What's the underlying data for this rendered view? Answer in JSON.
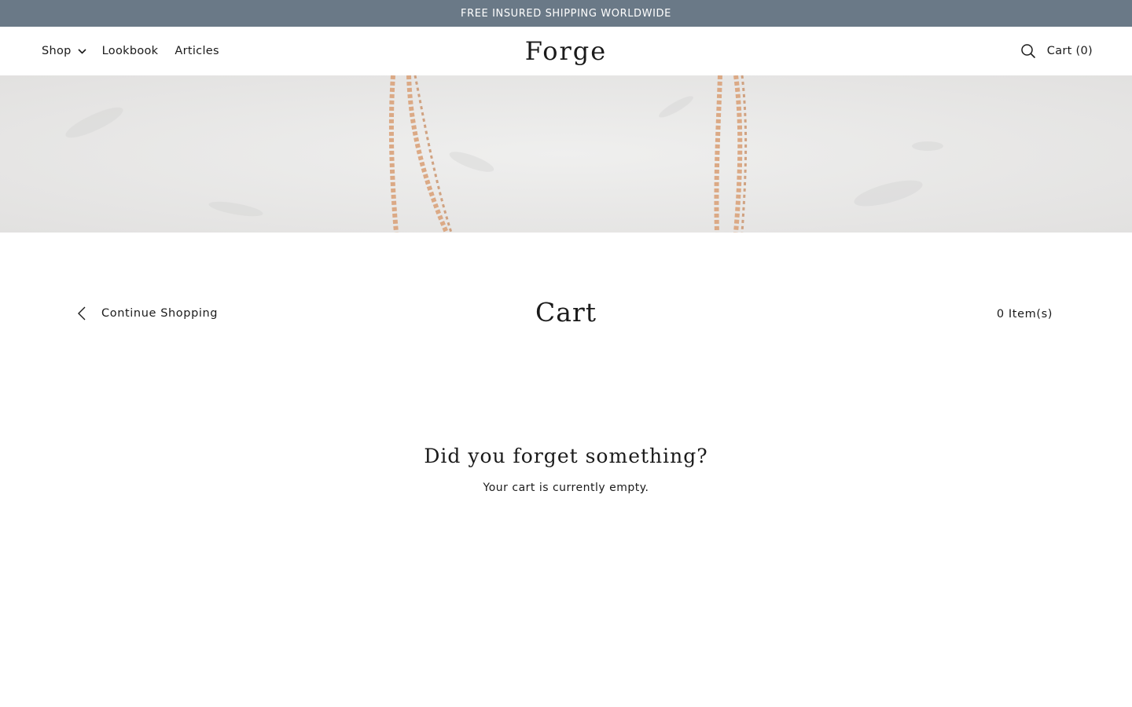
{
  "announcement": {
    "text": "FREE INSURED SHIPPING WORLDWIDE"
  },
  "header": {
    "nav": [
      {
        "label": "Shop"
      },
      {
        "label": "Lookbook"
      },
      {
        "label": "Articles"
      }
    ],
    "logo": "Forge",
    "cart_label": "Cart (0)"
  },
  "cart": {
    "continue_label": "Continue Shopping",
    "title": "Cart",
    "item_count": "0 Item(s)",
    "empty_heading": "Did you forget something?",
    "empty_message": "Your cart is currently empty."
  },
  "icons": {
    "shop_dropdown": "chevron-down-icon",
    "search": "search-icon",
    "back": "chevron-left-icon"
  },
  "colors": {
    "announcement_bg": "#6a7987",
    "announcement_text": "#ffffff",
    "text": "#1a1a1a",
    "hero_bg": "#e9e9e8",
    "chain_gold": "#d9a27a"
  }
}
